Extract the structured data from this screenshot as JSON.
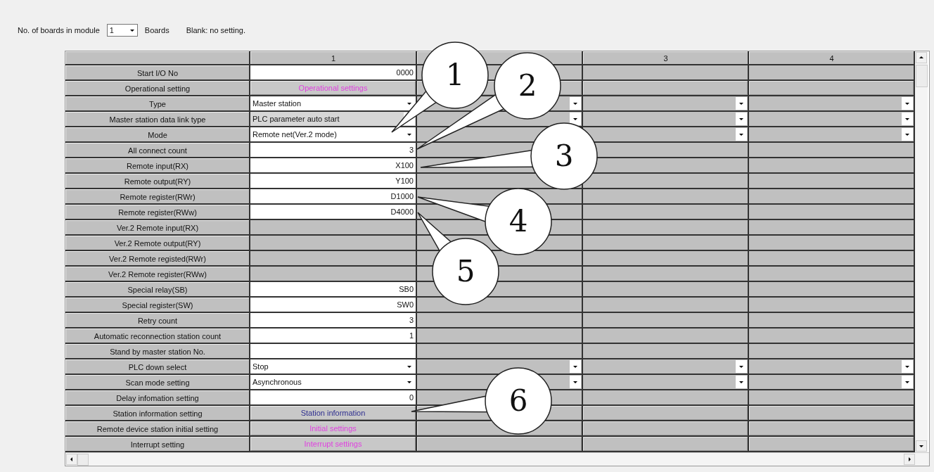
{
  "toolbar": {
    "label": "No. of boards in module",
    "boards": {
      "value": "1"
    },
    "unit": "Boards",
    "note": "Blank: no setting."
  },
  "table": {
    "columns": [
      {
        "label": "1"
      },
      {},
      {
        "label": "3"
      },
      {
        "label": "4"
      }
    ],
    "rows": [
      {
        "label": "Start I/O No",
        "kind": "input",
        "value": "0000"
      },
      {
        "label": "Operational setting",
        "kind": "button",
        "value": "Operational settings",
        "color": "#e040e0"
      },
      {
        "label": "Type",
        "kind": "dropdown",
        "value": "Master station",
        "disabled": false
      },
      {
        "label": "Master station data link type",
        "kind": "dropdown",
        "value": "PLC parameter auto start",
        "disabled": true
      },
      {
        "label": "Mode",
        "kind": "dropdown",
        "value": "Remote net(Ver.2 mode)",
        "disabled": false
      },
      {
        "label": "All connect count",
        "kind": "input",
        "value": "3"
      },
      {
        "label": "Remote input(RX)",
        "kind": "input",
        "value": "X100"
      },
      {
        "label": "Remote output(RY)",
        "kind": "input",
        "value": "Y100"
      },
      {
        "label": "Remote register(RWr)",
        "kind": "input",
        "value": "D1000"
      },
      {
        "label": "Remote register(RWw)",
        "kind": "input",
        "value": "D4000"
      },
      {
        "label": "Ver.2 Remote input(RX)",
        "kind": "blank"
      },
      {
        "label": "Ver.2 Remote output(RY)",
        "kind": "blank"
      },
      {
        "label": "Ver.2 Remote registed(RWr)",
        "kind": "blank"
      },
      {
        "label": "Ver.2 Remote register(RWw)",
        "kind": "blank"
      },
      {
        "label": "Special relay(SB)",
        "kind": "input",
        "value": "SB0"
      },
      {
        "label": "Special register(SW)",
        "kind": "input",
        "value": "SW0"
      },
      {
        "label": "Retry count",
        "kind": "input",
        "value": "3"
      },
      {
        "label": "Automatic reconnection station count",
        "kind": "input",
        "value": "1"
      },
      {
        "label": "Stand by master station No.",
        "kind": "input"
      },
      {
        "label": "PLC down select",
        "kind": "dropdown",
        "value": "Stop",
        "disabled": false
      },
      {
        "label": "Scan mode setting",
        "kind": "dropdown",
        "value": "Asynchronous",
        "disabled": false
      },
      {
        "label": "Delay infomation setting",
        "kind": "input",
        "value": "0"
      },
      {
        "label": "Station information setting",
        "kind": "button",
        "value": "Station information",
        "color": "#303090"
      },
      {
        "label": "Remote device station initial setting",
        "kind": "button",
        "value": "Initial settings",
        "color": "#e040e0"
      },
      {
        "label": "Interrupt setting",
        "kind": "button",
        "value": "Interrupt settings",
        "color": "#e040e0"
      }
    ]
  },
  "callouts": [
    {
      "number": "1"
    },
    {
      "number": "2"
    },
    {
      "number": "3"
    },
    {
      "number": "4"
    },
    {
      "number": "5"
    },
    {
      "number": "6"
    }
  ]
}
